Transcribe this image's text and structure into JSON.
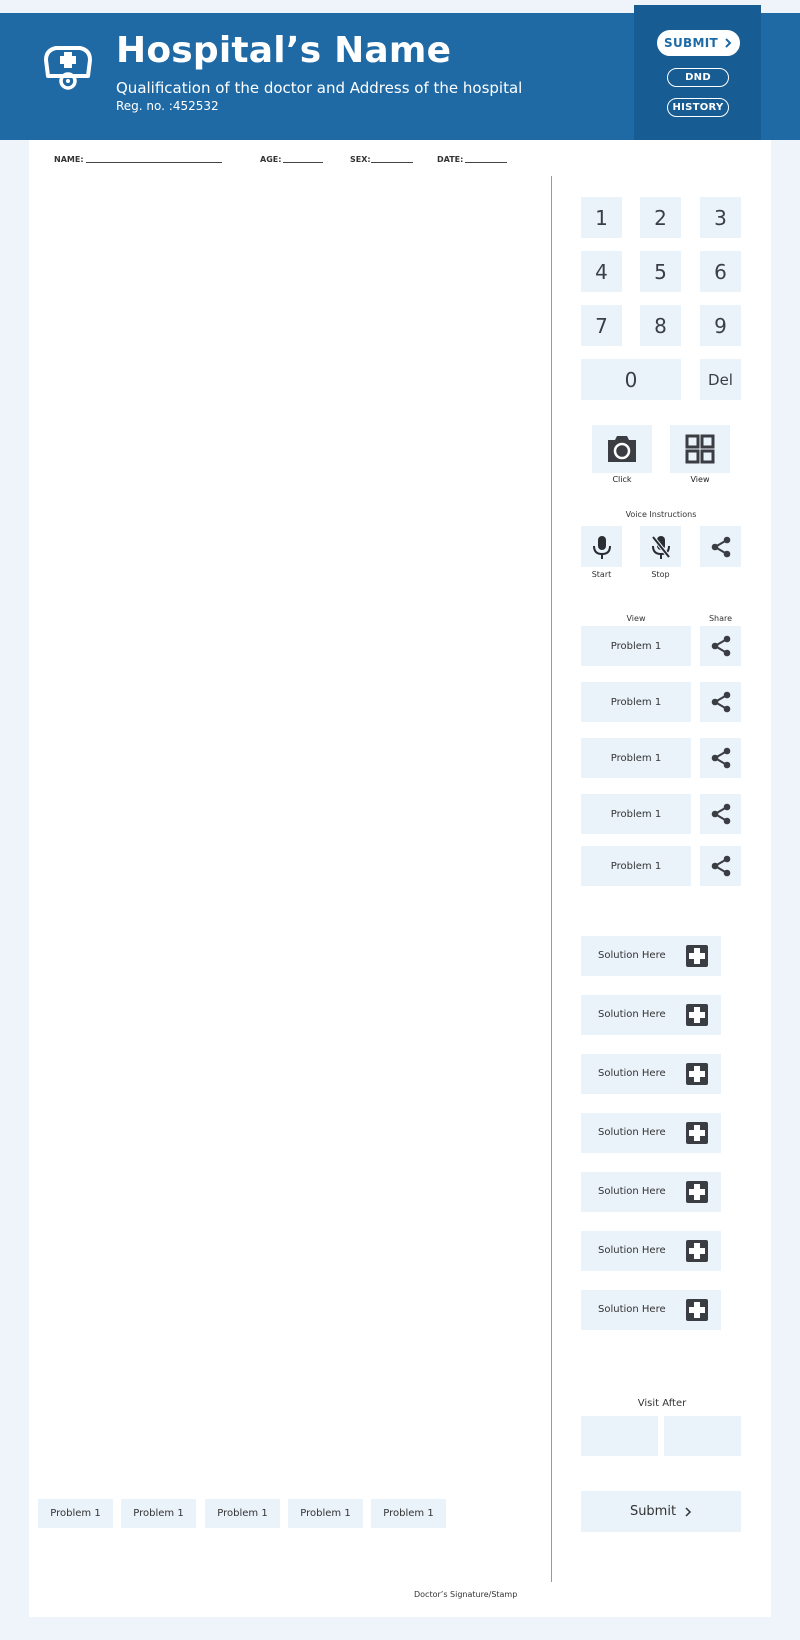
{
  "header": {
    "hospital_name": "Hospital’s Name",
    "subtitle": "Qualification of the doctor and Address of the hospital",
    "reg_no": "Reg. no. :452532",
    "logo_icon": "nurse-cap-stethoscope-icon",
    "buttons": {
      "submit": "SUBMIT",
      "dnd": "DND",
      "history": "HISTORY"
    }
  },
  "patient": {
    "name_label": "NAME:",
    "age_label": "AGE:",
    "sex_label": "SEX:",
    "date_label": "DATE:"
  },
  "keypad": {
    "keys": [
      "1",
      "2",
      "3",
      "4",
      "5",
      "6",
      "7",
      "8",
      "9"
    ],
    "zero": "0",
    "del": "Del"
  },
  "camera": {
    "click_label": "Click",
    "view_label": "View"
  },
  "voice": {
    "title": "Voice Instructions",
    "start_label": "Start",
    "stop_label": "Stop"
  },
  "problems": {
    "view_header": "View",
    "share_header": "Share",
    "items": [
      "Problem 1",
      "Problem 1",
      "Problem 1",
      "Problem 1",
      "Problem 1"
    ]
  },
  "solutions": {
    "items": [
      "Solution Here",
      "Solution Here",
      "Solution Here",
      "Solution Here",
      "Solution Here",
      "Solution Here",
      "Solution Here"
    ]
  },
  "visit": {
    "title": "Visit After",
    "value1": "",
    "value2": ""
  },
  "submit_label": "Submit",
  "bottom_problems": [
    "Problem 1",
    "Problem 1",
    "Problem 1",
    "Problem 1",
    "Problem 1"
  ],
  "signature": "Doctor’s Signature/Stamp",
  "colors": {
    "header": "#1f6aa5",
    "panel": "#175c92",
    "tile": "#eaf2fa",
    "page": "#eef4fa",
    "divider": "#6fa3d8"
  }
}
